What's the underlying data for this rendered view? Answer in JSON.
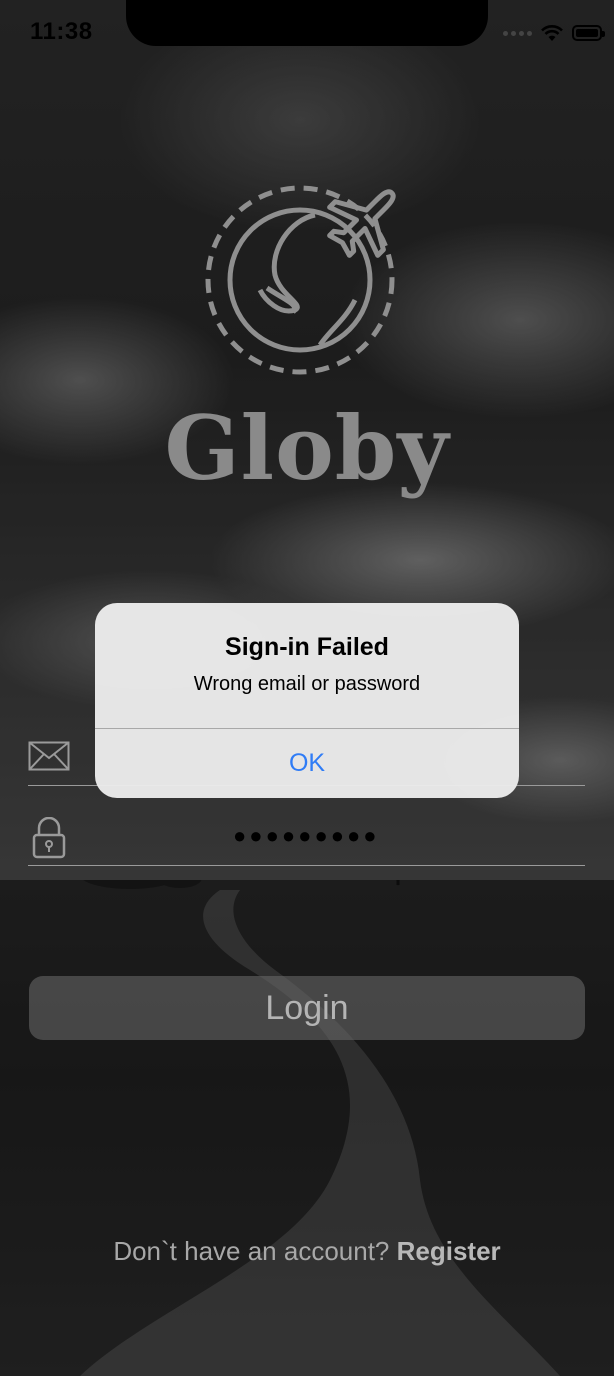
{
  "status_bar": {
    "time": "11:38"
  },
  "app": {
    "name": "Globy"
  },
  "form": {
    "email": {
      "value": "",
      "placeholder": ""
    },
    "password": {
      "value": "●●●●●●●●●"
    },
    "login_label": "Login"
  },
  "register": {
    "prompt": "Don`t have an account?",
    "link": "Register"
  },
  "alert": {
    "title": "Sign-in Failed",
    "message": "Wrong email or password",
    "ok_label": "OK"
  },
  "colors": {
    "alert_button": "#2f7cf6",
    "logo": "#8a8a8a"
  }
}
